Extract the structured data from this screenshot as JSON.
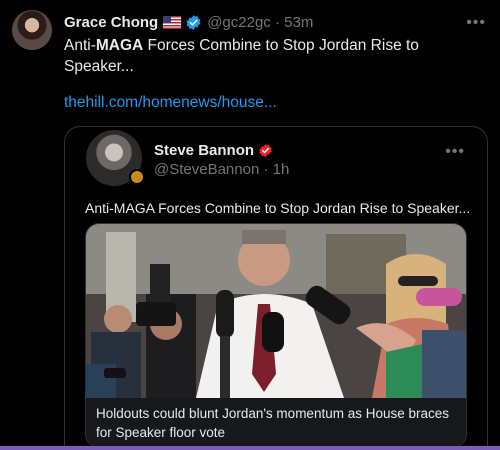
{
  "tweet": {
    "display_name": "Grace Chong",
    "flag_icon": "us-flag-icon",
    "handle": "@gc22gc",
    "time": "53m",
    "text_pre": "Anti-",
    "text_bold": "MAGA",
    "text_post": " Forces Combine to Stop Jordan Rise to Speaker...",
    "link": "thehill.com/homenews/house..."
  },
  "quote": {
    "display_name": "Steve Bannon",
    "handle": "@SteveBannon",
    "time": "1h",
    "text": "Anti-MAGA Forces Combine to Stop Jordan Rise to Speaker...",
    "card_caption": "Holdouts could blunt Jordan's momentum as House braces for Speaker floor vote"
  },
  "colors": {
    "background": "#000000",
    "link": "#1d9bf0",
    "muted": "#71767b",
    "verified_blue": "#1d9bf0",
    "verified_red": "#f4212e"
  }
}
